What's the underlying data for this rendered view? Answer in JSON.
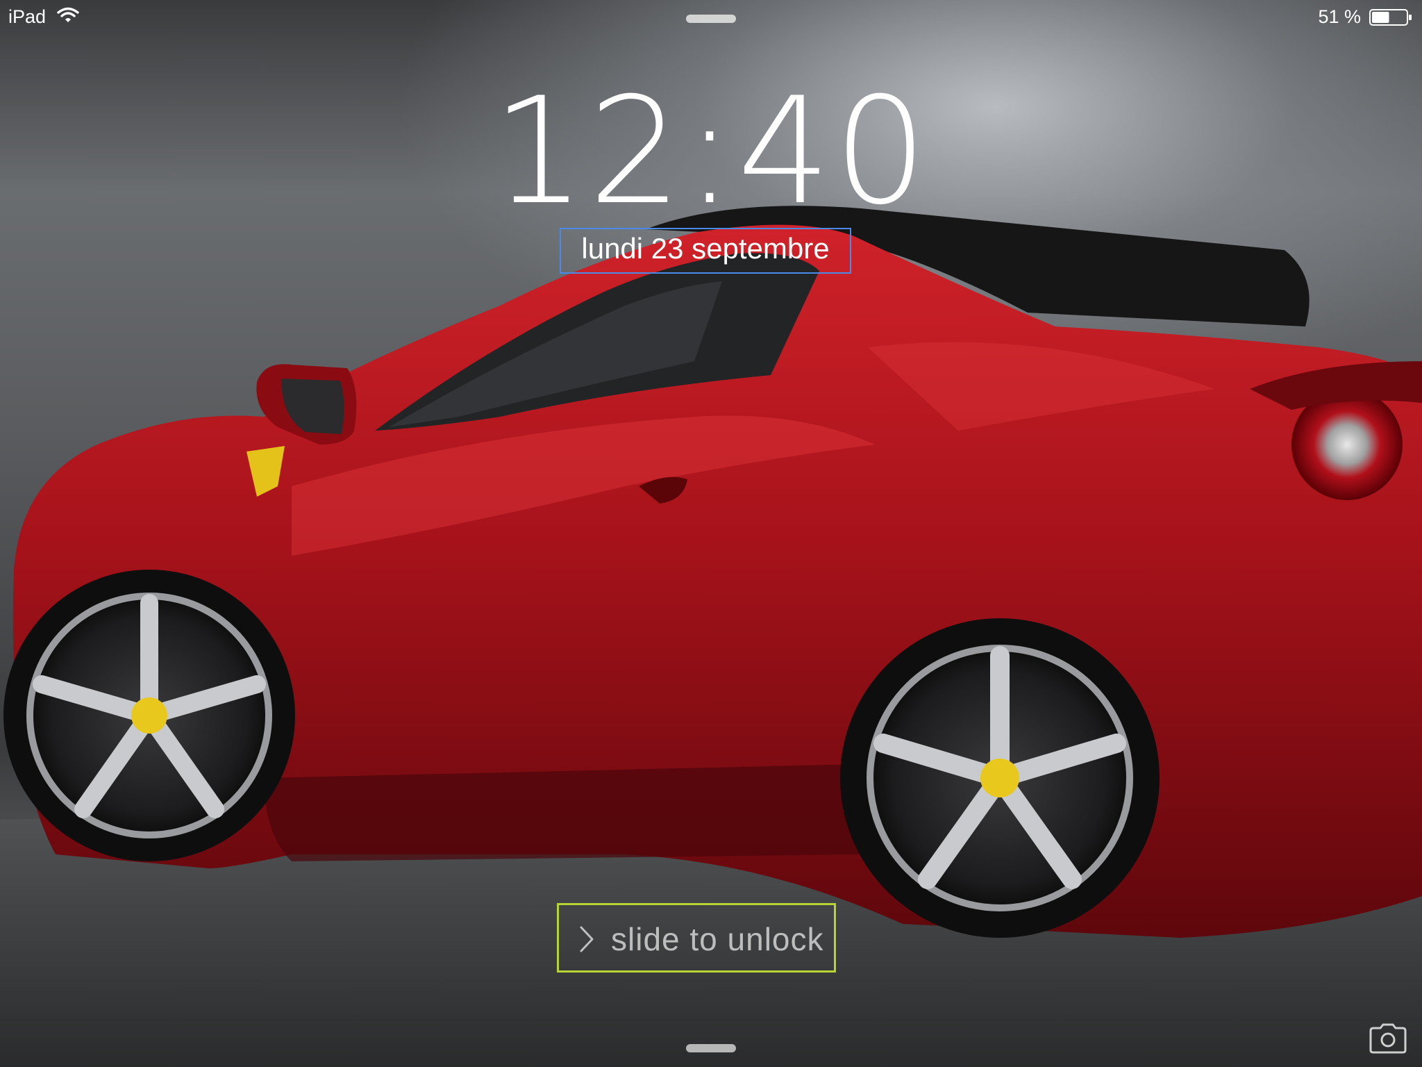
{
  "status_bar": {
    "carrier": "iPad",
    "battery_percent_label": "51 %",
    "battery_level": 0.51,
    "wifi_icon": "wifi-icon",
    "battery_icon": "battery-icon"
  },
  "lock_screen": {
    "time": "12:40",
    "date": "lundi 23 septembre",
    "slide_label": "slide to unlock",
    "slide_icon": "chevron-right-icon",
    "camera_icon": "camera-icon",
    "wallpaper": "red-sports-car"
  },
  "colors": {
    "date_highlight": "#4a8bea",
    "unlock_highlight": "#b6d433",
    "car_red": "#b0121b"
  }
}
